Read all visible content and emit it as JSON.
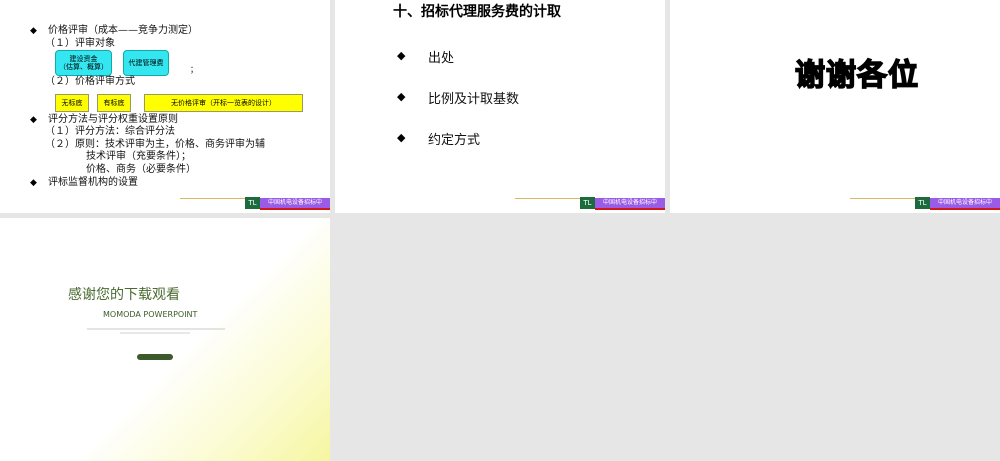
{
  "slide1": {
    "lines": [
      "价格评审（成本——竞争力测定）",
      "（１）评审对象",
      "（２）价格评审方式",
      "评分方法与评分权重设置原则",
      "（１）评分方法：综合评分法",
      "（２）原则：技术评审为主，价格、商务评审为辅",
      "技术评审（充要条件）；",
      "价格、商务（必要条件）",
      "评标监督机构的设置"
    ],
    "cyan_boxes": [
      "建设资金\n（估算、概算）",
      "代建管理费"
    ],
    "semicolon": "；",
    "yellow_boxes": [
      "无标底",
      "有标底",
      "无价格评审（开标一览表的设计）"
    ]
  },
  "slide2": {
    "title": "十、招标代理服务费的计取",
    "items": [
      "出处",
      "比例及计取基数",
      "约定方式"
    ]
  },
  "slide3": {
    "title": "谢谢各位"
  },
  "slide4": {
    "title": "感谢您的下载观看",
    "subtitle": "MOMODA POWERPOINT"
  },
  "footer": {
    "logo": "TL",
    "org": "中国机电设备招标中"
  }
}
